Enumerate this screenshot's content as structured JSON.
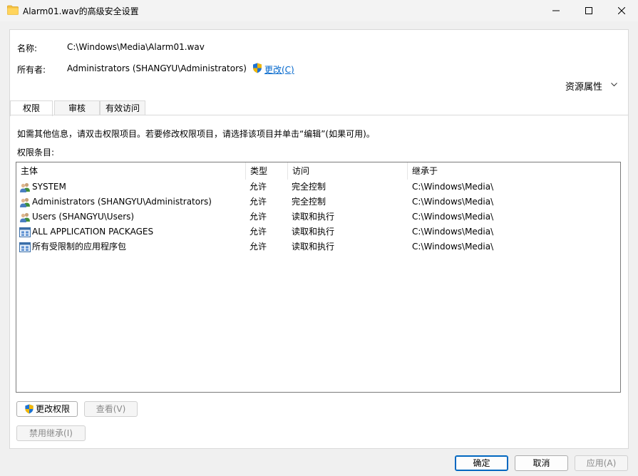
{
  "window": {
    "title": "Alarm01.wav的高级安全设置"
  },
  "info": {
    "name_label": "名称:",
    "name_value": "C:\\Windows\\Media\\Alarm01.wav",
    "owner_label": "所有者:",
    "owner_value": "Administrators (SHANGYU\\Administrators)",
    "change_link": "更改(C)",
    "resource_props": "资源属性"
  },
  "tabs": [
    {
      "label": "权限",
      "active": true
    },
    {
      "label": "审核",
      "active": false
    },
    {
      "label": "有效访问",
      "active": false
    }
  ],
  "instructions": "如需其他信息，请双击权限项目。若要修改权限项目，请选择该项目并单击“编辑”(如果可用)。",
  "entries_label": "权限条目:",
  "columns": [
    "主体",
    "类型",
    "访问",
    "继承于"
  ],
  "rows": [
    {
      "icon": "user-group-icon",
      "principal": "SYSTEM",
      "type": "允许",
      "access": "完全控制",
      "inherited": "C:\\Windows\\Media\\"
    },
    {
      "icon": "user-group-icon",
      "principal": "Administrators (SHANGYU\\Administrators)",
      "type": "允许",
      "access": "完全控制",
      "inherited": "C:\\Windows\\Media\\"
    },
    {
      "icon": "user-group-icon",
      "principal": "Users (SHANGYU\\Users)",
      "type": "允许",
      "access": "读取和执行",
      "inherited": "C:\\Windows\\Media\\"
    },
    {
      "icon": "app-package-icon",
      "principal": "ALL APPLICATION PACKAGES",
      "type": "允许",
      "access": "读取和执行",
      "inherited": "C:\\Windows\\Media\\"
    },
    {
      "icon": "app-package-icon",
      "principal": "所有受限制的应用程序包",
      "type": "允许",
      "access": "读取和执行",
      "inherited": "C:\\Windows\\Media\\"
    }
  ],
  "buttons": {
    "change_permissions": "更改权限",
    "view": "查看(V)",
    "disable_inheritance": "禁用继承(I)",
    "ok": "确定",
    "cancel": "取消",
    "apply": "应用(A)"
  },
  "colors": {
    "accent": "#0067c0",
    "link": "#0066cc"
  }
}
